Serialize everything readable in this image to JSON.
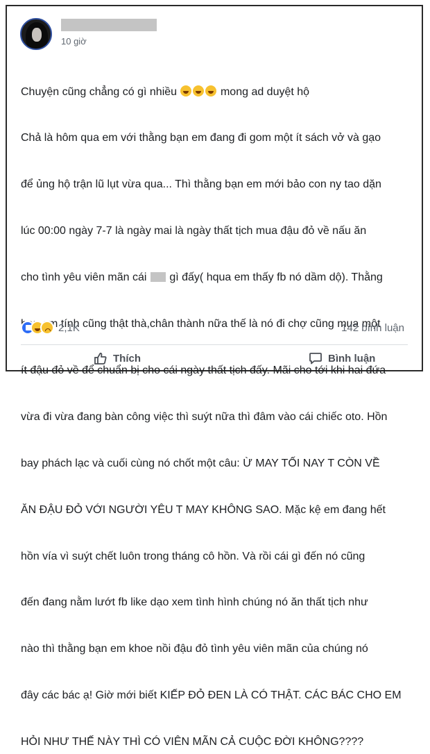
{
  "post": {
    "time": "10 giờ",
    "lines": [
      "Chuyện cũng chẳng có gì nhiều",
      "mong ad duyệt hộ",
      "Chả là hôm qua em với thằng bạn em đang đi gom một ít sách vở và gạo",
      "để ủng hộ trận lũ lụt vừa qua... Thì thằng bạn em mới bảo con ny tao dặn",
      "lúc 00:00 ngày 7-7 là ngày mai là ngày thất tịch mua đậu đỏ về nấu ăn",
      "cho tình yêu viên mãn cái",
      "gì đấy( hqua em thấy fb nó dầm dộ). Thằng",
      "bạn em tính cũng thật thà,chân thành nữa thế là nó đi chợ cũng mua một",
      "ít đậu đỏ về để chuẩn bị cho cái ngày thất tịch đấy. Mãi cho tới khi hai đứa",
      "vừa đi vừa đang bàn công việc thì suýt nữa thì đâm vào cái chiếc oto. Hồn",
      "bay phách lạc và cuối cùng nó chốt một câu: Ừ MAY TỐI NAY T CÒN VỀ",
      "ĂN ĐẬU ĐỎ VỚI NGƯỜI YÊU T MAY KHÔNG SAO. Mặc kệ em đang hết",
      "hồn vía vì suýt chết luôn trong tháng cô hồn. Và rồi cái gì đến nó cũng",
      "đến đang nằm lướt fb like dạo xem tình hình chúng nó ăn thất tịch như",
      "nào thì thằng bạn em khoe nồi đậu đỏ tình yêu viên mãn của chúng nó",
      "đây các bác ạ! Giờ mới biết KIẾP ĐỎ ĐEN LÀ CÓ THẬT. CÁC BÁC CHO EM",
      "HỎI NHƯ THẾ NÀY THÌ CÓ VIÊN MÃN CẢ CUỘC ĐỜI KHÔNG????"
    ]
  },
  "stats": {
    "reaction_count": "2,1K",
    "comment_count": "142 bình luận",
    "reactions": [
      "like",
      "haha",
      "sad"
    ]
  },
  "actions": {
    "like_label": "Thích",
    "comment_label": "Bình luận"
  },
  "icons": {
    "like": "thumbs-up-icon",
    "comment": "comment-bubble-icon"
  }
}
